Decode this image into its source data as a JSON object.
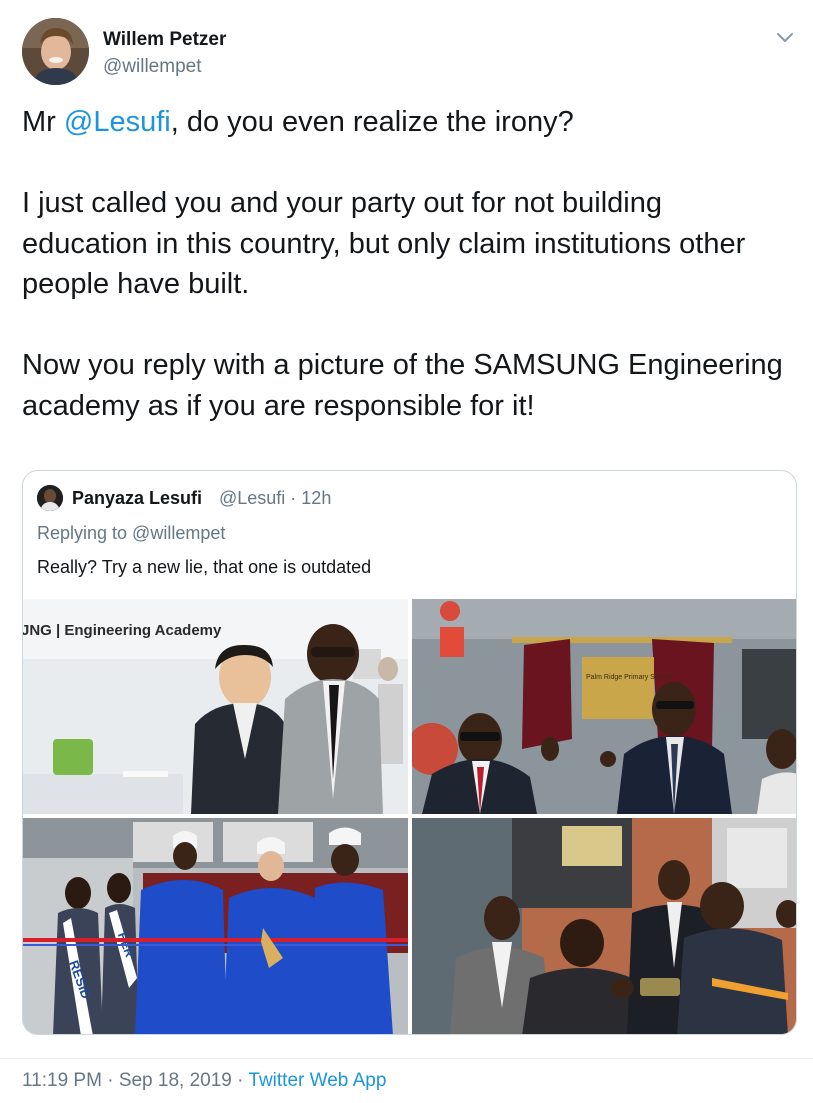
{
  "tweet": {
    "author": {
      "name": "Willem Petzer",
      "handle": "@willempet",
      "avatar_icon": "profile-photo"
    },
    "menu_icon": "chevron-down-icon",
    "text": {
      "prefix": "Mr ",
      "mention": "@Lesufi",
      "line1_rest": ", do you even realize the irony?",
      "paragraph2": "I just called you and your party out for not building education in this country, but only claim institutions other people have built.",
      "paragraph3": "Now you reply with a picture of the SAMSUNG Engineering academy as if you are responsible for it!"
    },
    "timestamp": {
      "time": "11:19 PM",
      "separator": " · ",
      "date": "Sep 18, 2019",
      "separator2": " · ",
      "source": "Twitter Web App"
    }
  },
  "quoted_tweet": {
    "author_name": "Panyaza Lesufi",
    "handle_and_time": "@Lesufi · 12h",
    "replying_to": "Replying to @willempet",
    "text": "Really? Try a new lie, that one is outdated",
    "photos": [
      {
        "sign_text": "JNG | Engineering Academy"
      },
      {
        "plaque_text": "Palm Ridge Primary School"
      },
      {
        "sash_left": "RESID",
        "sash_right": "HER"
      },
      {}
    ]
  }
}
